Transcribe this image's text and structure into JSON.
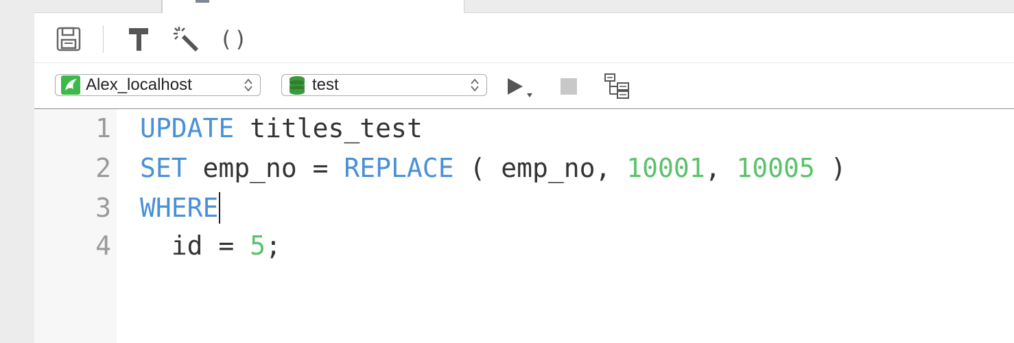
{
  "tabs": {
    "active_label": ""
  },
  "toolbar": {
    "buttons": [
      "save-icon",
      "hammer-icon",
      "magic-wand-icon",
      "parentheses-icon"
    ],
    "parens_glyph": "()"
  },
  "connection": {
    "label": "Alex_localhost",
    "icon": "mysql-dolphin-icon",
    "icon_color": "#3db84a"
  },
  "database": {
    "label": "test",
    "icon": "database-icon",
    "icon_color": "#3a9a3a"
  },
  "run": {
    "icon": "play-icon"
  },
  "stop": {
    "icon": "stop-icon"
  },
  "explain": {
    "icon": "explain-icon"
  },
  "editor": {
    "line_numbers": [
      "1",
      "2",
      "3",
      "4"
    ],
    "lines": [
      [
        {
          "t": "UPDATE",
          "c": "kw"
        },
        {
          "t": " titles_test",
          "c": ""
        }
      ],
      [
        {
          "t": "SET",
          "c": "kw"
        },
        {
          "t": " emp_no = ",
          "c": ""
        },
        {
          "t": "REPLACE",
          "c": "kw"
        },
        {
          "t": " ( emp_no, ",
          "c": ""
        },
        {
          "t": "10001",
          "c": "num"
        },
        {
          "t": ", ",
          "c": ""
        },
        {
          "t": "10005",
          "c": "num"
        },
        {
          "t": " )",
          "c": ""
        }
      ],
      [
        {
          "t": "WHERE",
          "c": "kw"
        }
      ],
      [
        {
          "t": "  id = ",
          "c": ""
        },
        {
          "t": "5",
          "c": "num"
        },
        {
          "t": ";",
          "c": ""
        }
      ]
    ],
    "keyword_color": "#4a90d9",
    "number_color": "#5ac26a"
  }
}
